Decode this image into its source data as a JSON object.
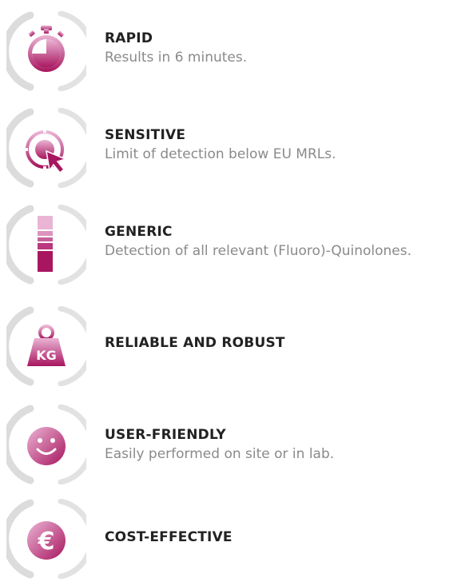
{
  "colors": {
    "accent_light": "#e7a7cc",
    "accent_dark": "#a6135f",
    "arc_gray": "#dcdcdc"
  },
  "features": [
    {
      "icon": "stopwatch-icon",
      "title": "RAPID",
      "description": "Results in 6 minutes."
    },
    {
      "icon": "target-cursor-icon",
      "title": "SENSITIVE",
      "description": "Limit of detection below EU MRLs."
    },
    {
      "icon": "test-strip-icon",
      "title": "GENERIC",
      "description": "Detection of all relevant (Fluoro)-Quinolones."
    },
    {
      "icon": "weight-kg-icon",
      "title": "RELIABLE AND ROBUST",
      "icon_text": "KG"
    },
    {
      "icon": "smiley-icon",
      "title": "USER-FRIENDLY",
      "description": "Easily performed on site or in lab."
    },
    {
      "icon": "euro-icon",
      "title": "COST-EFFECTIVE",
      "icon_text": "€"
    }
  ]
}
